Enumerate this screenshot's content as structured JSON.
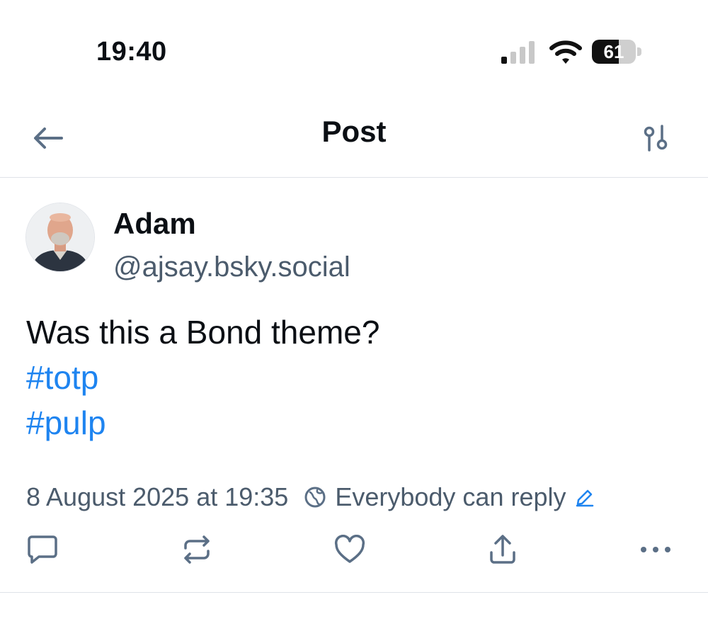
{
  "status_bar": {
    "time": "19:40",
    "battery_level": "61",
    "battery_fraction": 0.61,
    "signal_bars_active": 1,
    "signal_bars_total": 4
  },
  "header": {
    "title": "Post",
    "back_icon": "arrow-left-icon",
    "settings_icon": "sliders-icon"
  },
  "post": {
    "author_name": "Adam",
    "author_handle": "@ajsay.bsky.social",
    "text": "Was this a Bond theme?",
    "hashtags": [
      "#totp",
      "#pulp"
    ],
    "timestamp": "8 August 2025 at 19:35",
    "reply_setting": "Everybody can reply"
  },
  "actions": {
    "icons": [
      "reply-icon",
      "repost-icon",
      "like-icon",
      "share-icon",
      "more-icon"
    ]
  },
  "colors": {
    "accent": "#1e84f0",
    "icon": "#5b6f86",
    "muted_text": "#4b5b6c"
  }
}
